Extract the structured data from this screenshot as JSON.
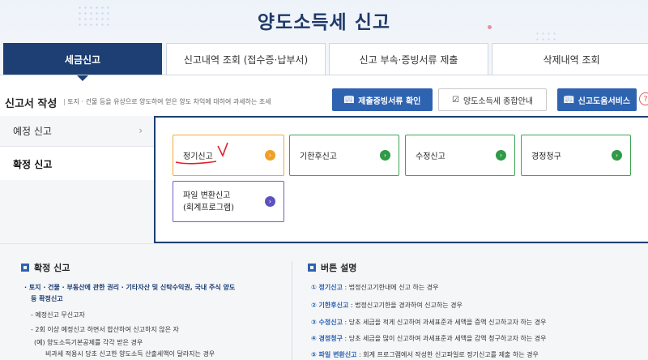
{
  "header": {
    "title": "양도소득세 신고"
  },
  "tabs": [
    {
      "label": "세금신고"
    },
    {
      "label": "신고내역 조회 (접수증·납부서)"
    },
    {
      "label": "신고 부속·증빙서류 제출"
    },
    {
      "label": "삭제내역 조회"
    }
  ],
  "section": {
    "title": "신고서 작성",
    "description": "토지 · 건물 등을 유상으로 양도하여 얻은 양도 차익에 대하여 과세하는 조세"
  },
  "buttons": {
    "evidence": "제출증빙서류 확인",
    "guide": "양도소득세 종합안내",
    "help_service": "신고도움서비스",
    "help_icon": "?"
  },
  "sidebar": {
    "items": [
      {
        "label": "예정 신고",
        "chevron": "›"
      },
      {
        "label": "확정 신고"
      }
    ]
  },
  "options": [
    {
      "label": "정기신고",
      "arrow": "›"
    },
    {
      "label": "기한후신고",
      "arrow": "›"
    },
    {
      "label": "수정신고",
      "arrow": "›"
    },
    {
      "label": "경정청구",
      "arrow": "›"
    },
    {
      "label_line1": "파일 변환신고",
      "label_line2": "(회계프로그램)",
      "arrow": "›"
    }
  ],
  "confirm_section": {
    "title": "확정 신고",
    "lines": [
      "· 토지 · 건물 · 부동산에 관한 권리 · 기타자산 및 신탁수익권, 국내 주식 양도",
      "등 확정신고",
      "- 예정신고 무신고자",
      "- 2회 이상 예정신고 하면서 합산하여 신고하지 않은 자",
      "(예) 양도소득기본공제를 각각 받은 경우",
      "비과세 적용시 당초 신고한 양도소득 산출세액이 달라지는 경우"
    ]
  },
  "button_desc": {
    "title": "버튼 설명",
    "items": [
      {
        "name": "① 정기신고",
        "text": " : 법정신고기한내에 신고 하는 경우"
      },
      {
        "name": "② 기한후신고",
        "text": " : 법정신고기한을 경과하여 신고하는 경우"
      },
      {
        "name": "③ 수정신고",
        "text": " : 당초 세금을 적게 신고하여 과세표준과 세액을 증액 신고하고자 하는 경우"
      },
      {
        "name": "④ 경정청구",
        "text": " : 당초 세금을 많이 신고하여 과세표준과 세액을 감액 청구하고자 하는 경우"
      },
      {
        "name": "⑤ 파일 변환신고",
        "text": " : 회계 프로그램에서 작성한 신고파일로 정기신고를 제출 하는 경우"
      }
    ]
  },
  "colors": {
    "navy": "#1d3f73",
    "blue_button": "#2e63b0",
    "orange": "#f0a025",
    "green": "#2e9b46",
    "purple": "#5b52c0",
    "annotation_red": "#e0202a"
  }
}
